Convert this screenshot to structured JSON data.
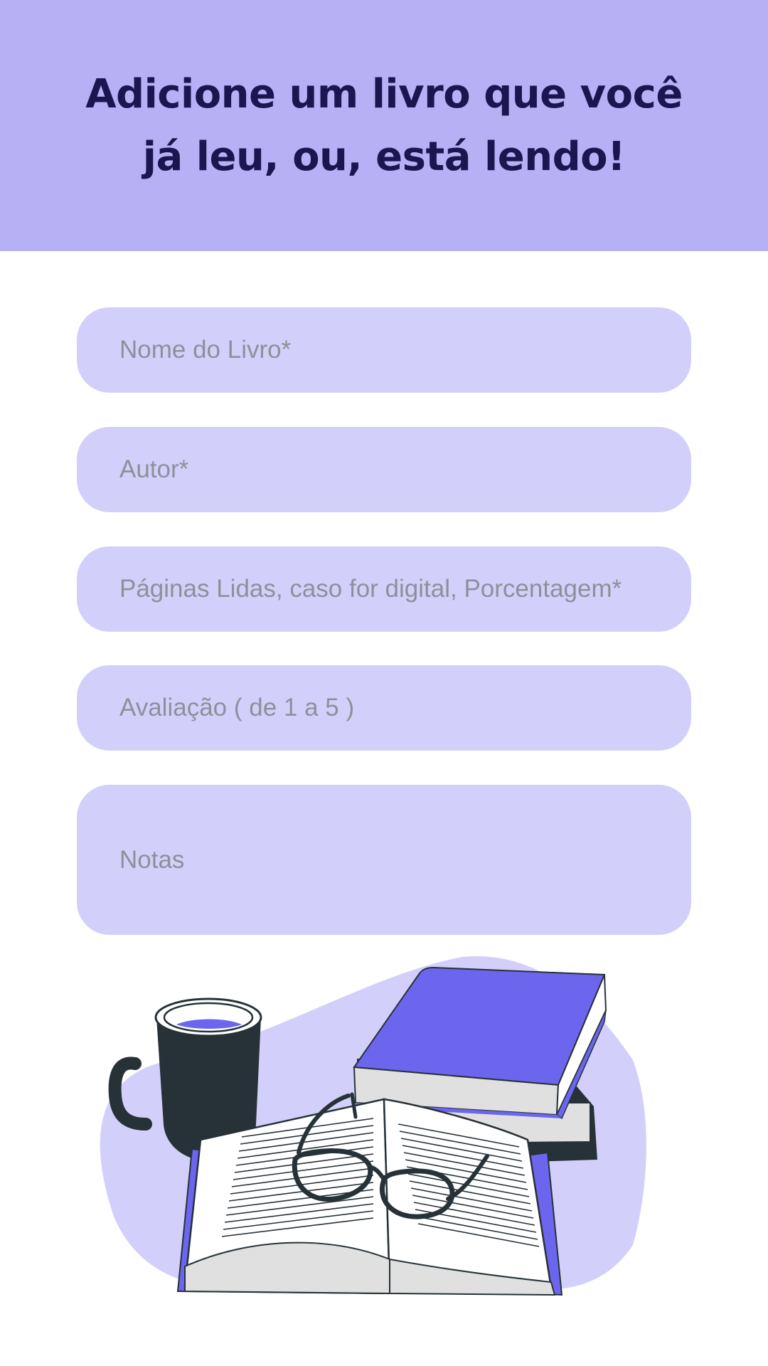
{
  "header": {
    "title": "Adicione um livro que você já leu, ou, está lendo!"
  },
  "form": {
    "book_name_placeholder": "Nome do Livro*",
    "author_placeholder": "Autor*",
    "pages_placeholder": "Páginas Lidas, caso for digital, Porcentagem*",
    "rating_placeholder": "Avaliação ( de 1 a 5 )",
    "notes_placeholder": "Notas"
  },
  "illustration": {
    "icon": "books-coffee-glasses-illustration"
  },
  "colors": {
    "header_bg": "#b8b0f5",
    "title_text": "#1c1650",
    "field_bg": "#d2d0fa",
    "placeholder_text": "#8f8f9b",
    "book_accent": "#6c66ee",
    "ink": "#263238"
  }
}
